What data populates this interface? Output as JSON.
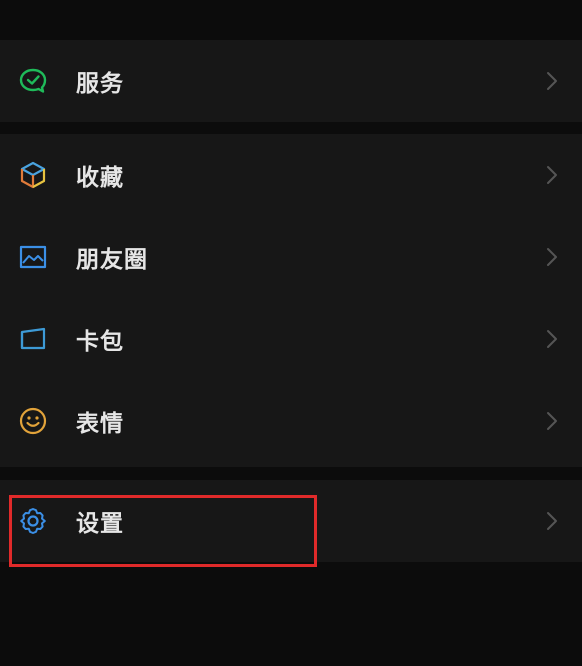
{
  "menu": {
    "services": {
      "label": "服务",
      "icon": "wechat-pay-check-icon",
      "color": "#1fbb5a"
    },
    "favorites": {
      "label": "收藏",
      "icon": "cube-icon"
    },
    "moments": {
      "label": "朋友圈",
      "icon": "picture-icon",
      "color": "#3b8fe6"
    },
    "cards": {
      "label": "卡包",
      "icon": "card-wallet-icon",
      "color": "#3d9ad6"
    },
    "stickers": {
      "label": "表情",
      "icon": "smiley-icon",
      "color": "#e2a33a"
    },
    "settings": {
      "label": "设置",
      "icon": "gear-icon",
      "color": "#3b8fe6"
    }
  },
  "highlight": {
    "color": "#e02a2a",
    "target": "settings"
  }
}
